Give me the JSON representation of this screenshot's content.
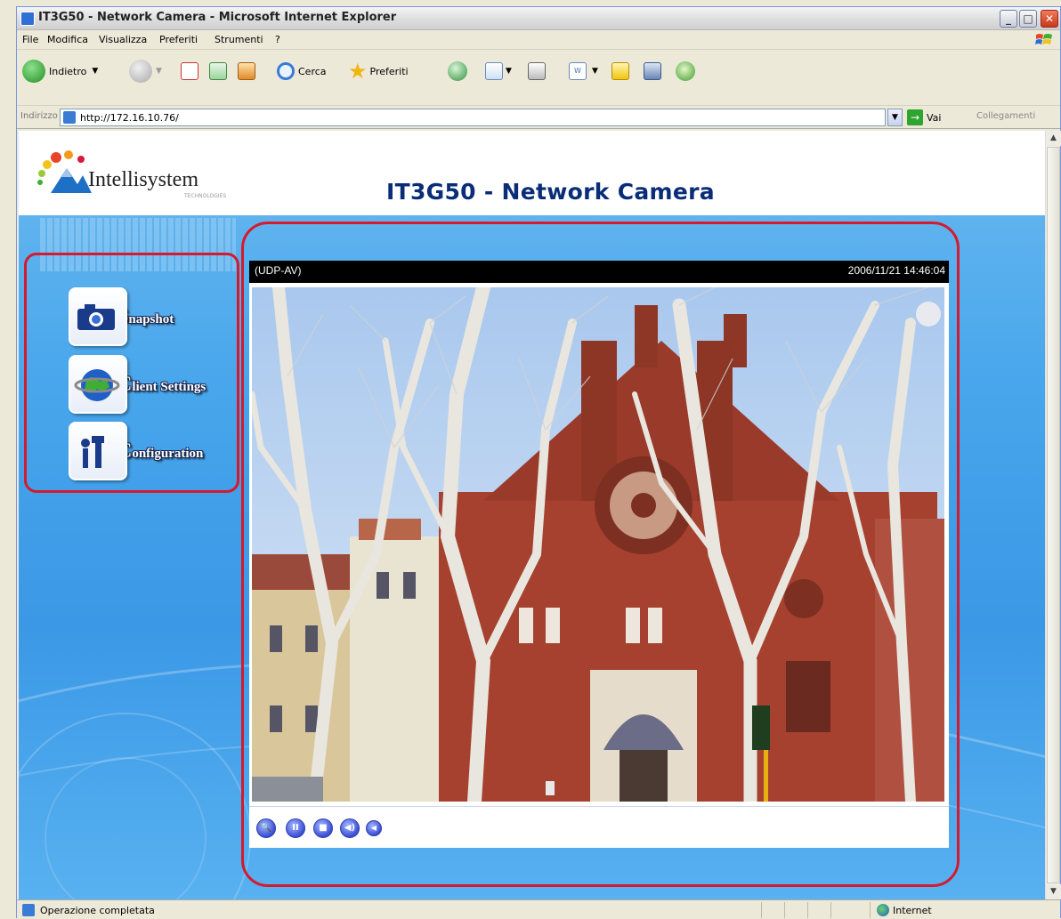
{
  "window": {
    "title": "IT3G50 - Network Camera - Microsoft Internet Explorer"
  },
  "menu": [
    "File",
    "Modifica",
    "Visualizza",
    "Preferiti",
    "Strumenti",
    "?"
  ],
  "toolbar": {
    "back_label": "Indietro",
    "search_label": "Cerca",
    "favorites_label": "Preferiti"
  },
  "address": {
    "label": "Indirizzo",
    "url": "http://172.16.10.76/",
    "go_label": "Vai",
    "links_label": "Collegamenti"
  },
  "page": {
    "logo_text": "Intellisystem",
    "logo_sub": "TECHNOLOGIES",
    "title": "IT3G50 - Network Camera"
  },
  "nav": [
    {
      "cap": "S",
      "rest": "napshot",
      "icon": "camera-icon"
    },
    {
      "cap": "C",
      "rest": "lient Settings",
      "icon": "globe-icon"
    },
    {
      "cap": "C",
      "rest": "onfiguration",
      "icon": "tools-icon"
    }
  ],
  "video": {
    "mode": "(UDP-AV)",
    "timestamp": "2006/11/21 14:46:04",
    "controls": [
      "zoom-icon",
      "pause-icon",
      "stop-icon",
      "volume-icon",
      "mute-icon"
    ]
  },
  "status": {
    "text": "Operazione completata",
    "zone": "Internet"
  },
  "colors": {
    "accent_red": "#d41a2c",
    "title_blue": "#0a2d78",
    "page_blue": "#48a6ec"
  }
}
